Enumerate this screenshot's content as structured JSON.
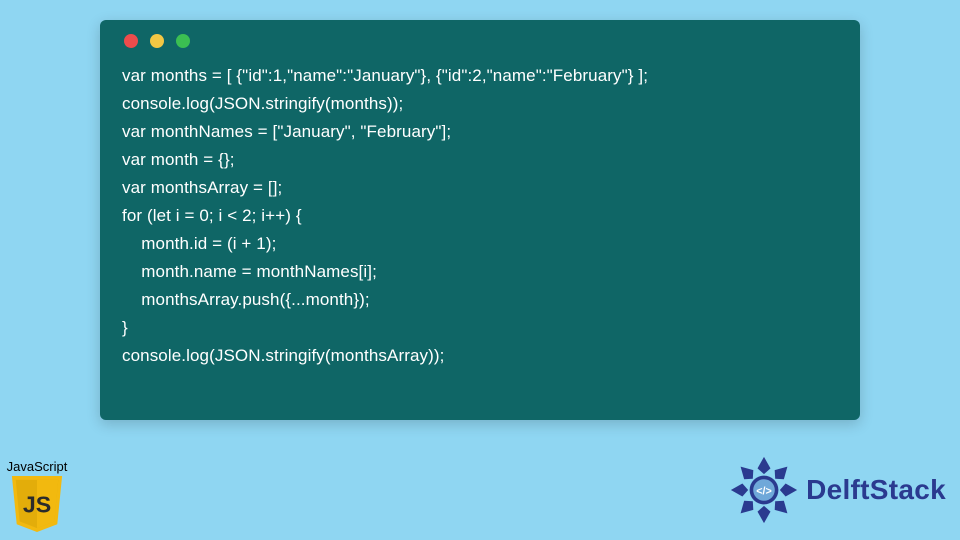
{
  "window": {
    "dot_colors": {
      "red": "#ed4c4c",
      "yellow": "#f2c744",
      "green": "#3bbf52"
    }
  },
  "code_lines": [
    "var months = [ {\"id\":1,\"name\":\"January\"}, {\"id\":2,\"name\":\"February\"} ];",
    "console.log(JSON.stringify(months));",
    "var monthNames = [\"January\", \"February\"];",
    "var month = {};",
    "var monthsArray = [];",
    "for (let i = 0; i < 2; i++) {",
    "    month.id = (i + 1);",
    "    month.name = monthNames[i];",
    "    monthsArray.push({...month});",
    "}",
    "console.log(JSON.stringify(monthsArray));"
  ],
  "js_badge": {
    "label": "JavaScript",
    "letters": "JS"
  },
  "brand": {
    "name": "DelftStack"
  },
  "colors": {
    "page_bg": "#8fd6f2",
    "window_bg": "#0f6666",
    "code_fg": "#ffffff",
    "brand_fg": "#2a3a8f",
    "js_bg": "#f2b90f"
  }
}
